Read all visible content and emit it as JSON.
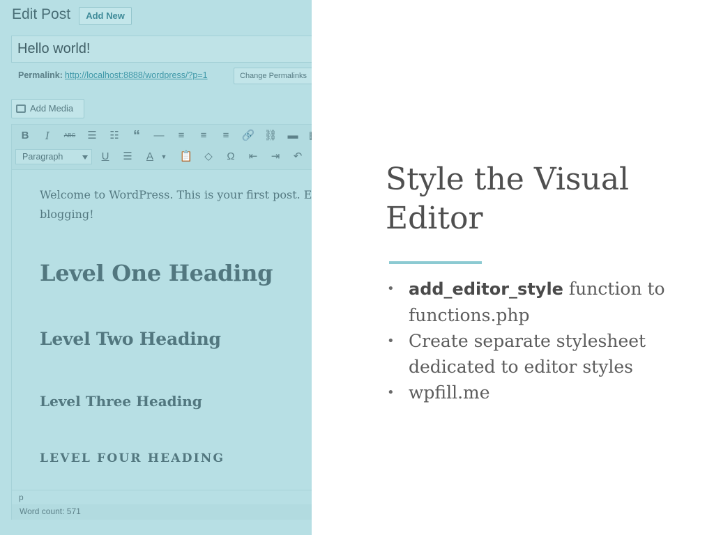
{
  "editor": {
    "page_title": "Edit Post",
    "add_new_label": "Add New",
    "post_title": "Hello world!",
    "permalink_label": "Permalink:",
    "permalink_url": "http://localhost:8888/wordpress/?p=1",
    "change_permalinks_label": "Change Permalinks",
    "add_media_label": "Add Media",
    "format_select_value": "Paragraph",
    "content": {
      "paragraph": "Welcome to WordPress. This is your first post. Ed",
      "paragraph_line2": "blogging!",
      "heading1": "Level One Heading",
      "heading2": "Level Two Heading",
      "heading3": "Level Three Heading",
      "heading4": "Level Four Heading"
    },
    "path": "p",
    "word_count": "Word count: 571"
  },
  "slide": {
    "title": "Style the Visual Editor",
    "bullets": [
      {
        "strong": "add_editor_style",
        "text": " function to functions.php"
      },
      {
        "text": "Create separate stylesheet dedicated to editor styles"
      },
      {
        "text": "wpfill.me"
      }
    ]
  },
  "colors": {
    "editor_overlay": "#b7dfe4",
    "accent_rule": "#8ccad2",
    "slide_text": "#4f4f4f"
  }
}
